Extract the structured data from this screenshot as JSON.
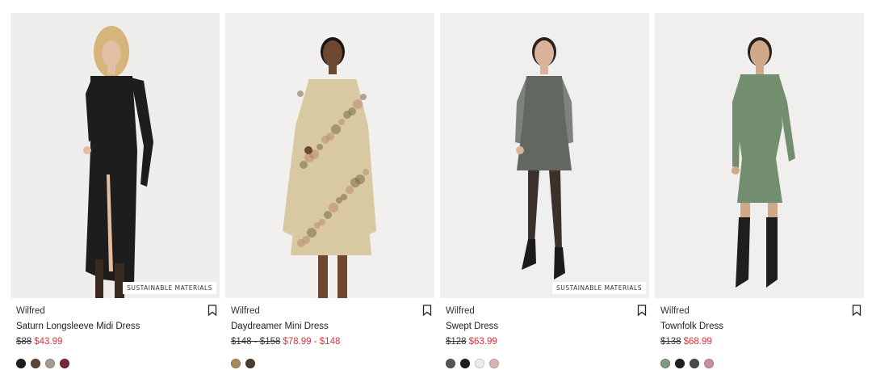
{
  "products": [
    {
      "badge": "SUSTAINABLE MATERIALS",
      "brand": "Wilfred",
      "name": "Saturn Longsleeve Midi Dress",
      "original_price": "$88",
      "sale_price": "$43.99",
      "swatches": [
        "#1e1e1e",
        "#5e4432",
        "#a69c91",
        "#7a2636"
      ],
      "image_bg": "#efeeec",
      "garment_color": "#1d1d1d",
      "skin": "#e2bea3",
      "hair": "#d7b57a"
    },
    {
      "badge": "",
      "brand": "Wilfred",
      "name": "Daydreamer Mini Dress",
      "original_price": "$148 - $158",
      "sale_price": "$78.99 - $148",
      "swatches": [
        "#a78a5c",
        "#4c3b2b"
      ],
      "image_bg": "#f1f0ee",
      "garment_color": "#d9c9a3",
      "skin": "#6e4731",
      "hair": "#1c1612"
    },
    {
      "badge": "SUSTAINABLE MATERIALS",
      "brand": "Wilfred",
      "name": "Swept Dress",
      "original_price": "$128",
      "sale_price": "$63.99",
      "swatches": [
        "#55575a",
        "#1d1d1d",
        "#ecebe9",
        "#dbb3b2"
      ],
      "image_bg": "#efefef",
      "garment_color": "#626760",
      "skin": "#d9b49a",
      "hair": "#2c2019"
    },
    {
      "badge": "",
      "brand": "Wilfred",
      "name": "Townfolk Dress",
      "original_price": "$138",
      "sale_price": "$68.99",
      "swatches": [
        "#7f9a7c",
        "#1f1f1f",
        "#4a4a4a",
        "#c9909a"
      ],
      "image_bg": "#f0efed",
      "garment_color": "#728e6e",
      "skin": "#cfa88a",
      "hair": "#2a1e17"
    }
  ]
}
